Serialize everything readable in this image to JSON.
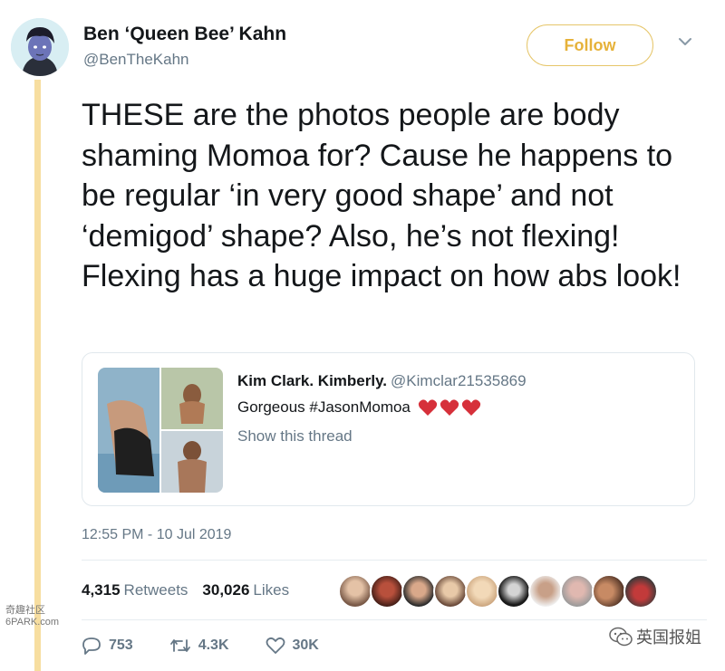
{
  "tweet": {
    "author_name": "Ben ‘Queen Bee’ Kahn",
    "author_handle": "@BenTheKahn",
    "follow_label": "Follow",
    "text": "THESE are the photos people are body shaming Momoa for? Cause he happens to be regular ‘in very good shape’ and not ‘demigod’ shape? Also, he’s not flexing! Flexing has a huge impact on how abs look!",
    "timestamp": "12:55 PM - 10 Jul 2019"
  },
  "quoted": {
    "author_name": "Kim Clark. Kimberly.",
    "author_handle": "@Kimclar21535869",
    "text": "Gorgeous #JasonMomoa",
    "show_thread": "Show this thread"
  },
  "stats": {
    "retweets_count": "4,315",
    "retweets_label": "Retweets",
    "likes_count": "30,026",
    "likes_label": "Likes"
  },
  "actions": {
    "replies": "753",
    "retweets": "4.3K",
    "likes": "30K"
  },
  "watermarks": {
    "left_line1": "奇趣社区",
    "left_line2": "6PARK.com",
    "right_text": "英国报姐"
  },
  "colors": {
    "accent": "#e6b23a",
    "follow_border": "#e6c66a",
    "thread_line": "#f7dea0",
    "secondary_text": "#657786",
    "heart": "#e0245e"
  },
  "icons": {
    "reply": "reply-icon",
    "retweet": "retweet-icon",
    "like": "heart-outline-icon",
    "more": "chevron-down-icon"
  }
}
